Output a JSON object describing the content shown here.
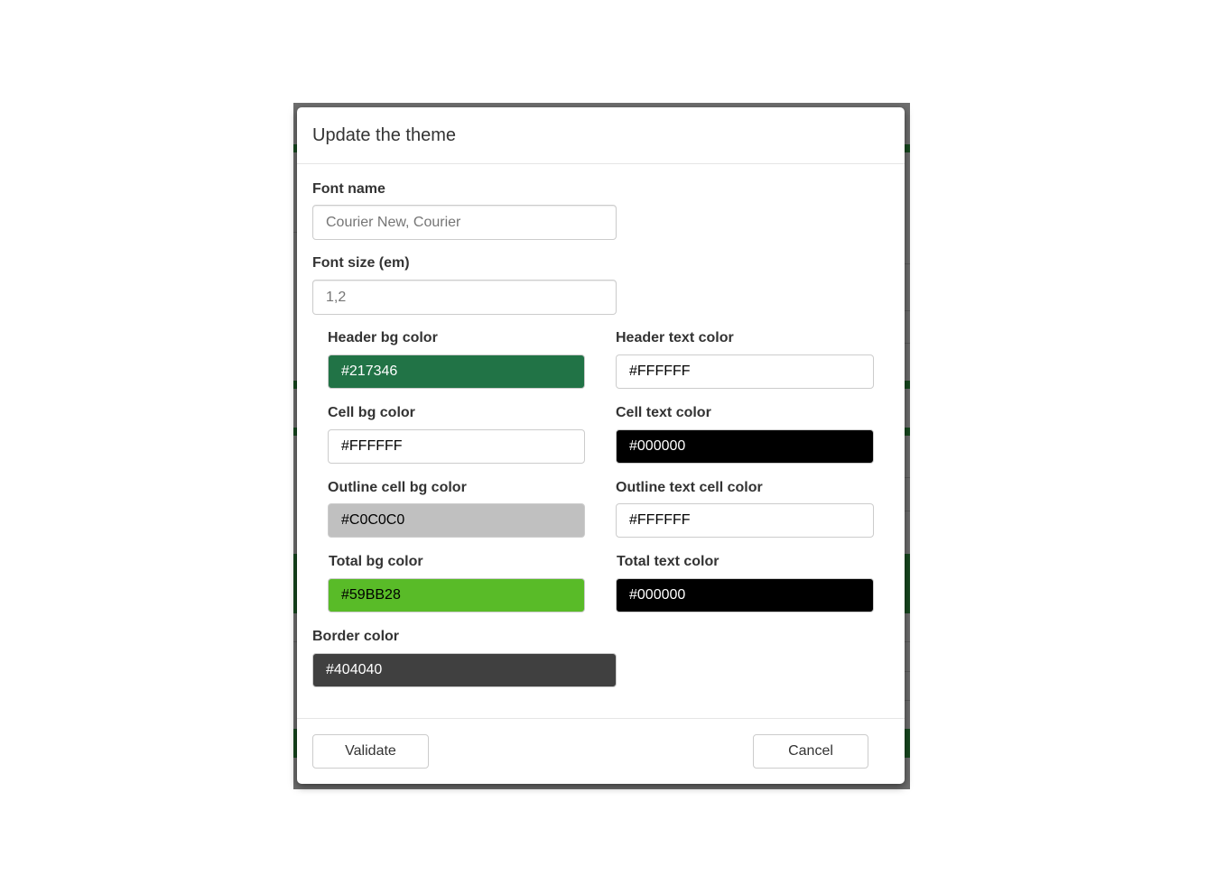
{
  "colors": {
    "overlay": "#6e6e6e",
    "modal_bg": "#ffffff",
    "label_text": "#333333",
    "input_border": "#cccccc"
  },
  "modal": {
    "title": "Update the theme"
  },
  "form": {
    "font_name": {
      "label": "Font name",
      "placeholder": "Courier New, Courier"
    },
    "font_size": {
      "label": "Font size (em)",
      "placeholder": "1,2"
    },
    "header_bg": {
      "label": "Header bg color",
      "value": "#217346",
      "bg": "#217346",
      "fg": "#ffffff"
    },
    "header_text": {
      "label": "Header text color",
      "value": "#FFFFFF",
      "bg": "#FFFFFF",
      "fg": "#000000"
    },
    "cell_bg": {
      "label": "Cell bg color",
      "value": "#FFFFFF",
      "bg": "#FFFFFF",
      "fg": "#000000"
    },
    "cell_text": {
      "label": "Cell text color",
      "value": "#000000",
      "bg": "#000000",
      "fg": "#ffffff"
    },
    "outline_cell_bg": {
      "label": "Outline cell bg color",
      "value": "#C0C0C0",
      "bg": "#C0C0C0",
      "fg": "#000000"
    },
    "outline_text_cell": {
      "label": "Outline text cell color",
      "value": "#FFFFFF",
      "bg": "#FFFFFF",
      "fg": "#000000"
    },
    "total_bg": {
      "label": "Total bg color",
      "value": "#59BB28",
      "bg": "#59BB28",
      "fg": "#000000"
    },
    "total_text": {
      "label": "Total text color",
      "value": "#000000",
      "bg": "#000000",
      "fg": "#ffffff"
    },
    "border": {
      "label": "Border color",
      "value": "#404040",
      "bg": "#404040",
      "fg": "#ffffff"
    }
  },
  "footer": {
    "validate_label": "Validate",
    "cancel_label": "Cancel"
  }
}
